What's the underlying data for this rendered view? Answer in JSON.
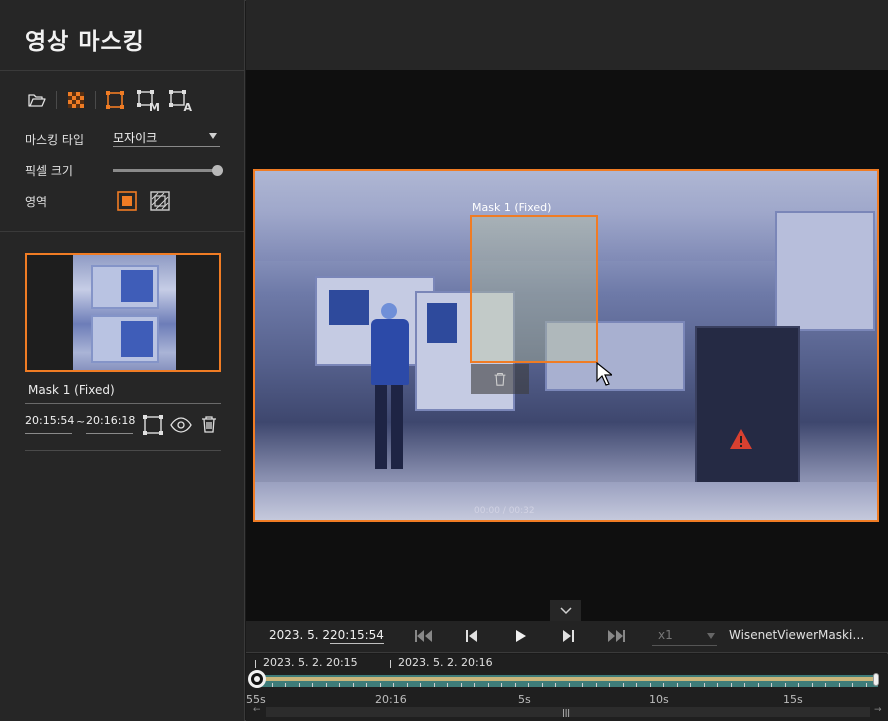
{
  "app": {
    "title": "영상 마스킹"
  },
  "toolbar": {
    "icons": [
      "folder-open-icon",
      "mosaic-icon",
      "rect-mask-icon",
      "rect-manual-icon",
      "rect-auto-icon"
    ],
    "manual_letter": "M",
    "auto_letter": "A"
  },
  "settings": {
    "masking_type_label": "마스킹 타입",
    "masking_type_value": "모자이크",
    "pixel_size_label": "픽셀 크기",
    "pixel_size_level": 1.0,
    "area_label": "영역"
  },
  "mask_item": {
    "name": "Mask 1 (Fixed)",
    "start_time": "20:15:54",
    "separator": "~",
    "end_time": "20:16:18"
  },
  "viewer": {
    "mask_label": "Mask 1 (Fixed)",
    "video_time": "00:00 / 00:32"
  },
  "controls": {
    "date": "2023. 5. 2.",
    "time": "20:15:54",
    "speed": "x1",
    "file_name": "WisenetViewerMaskin..."
  },
  "timeline": {
    "date_markers": [
      "2023. 5. 2. 20:15",
      "2023. 5. 2. 20:16"
    ],
    "labels": [
      "55s",
      "20:16",
      "5s",
      "10s",
      "15s"
    ],
    "playhead_position": 0.0
  },
  "colors": {
    "accent": "#f07c24",
    "panel": "#262626",
    "track": "#3e7c79",
    "track_fill": "#c9b57a"
  }
}
